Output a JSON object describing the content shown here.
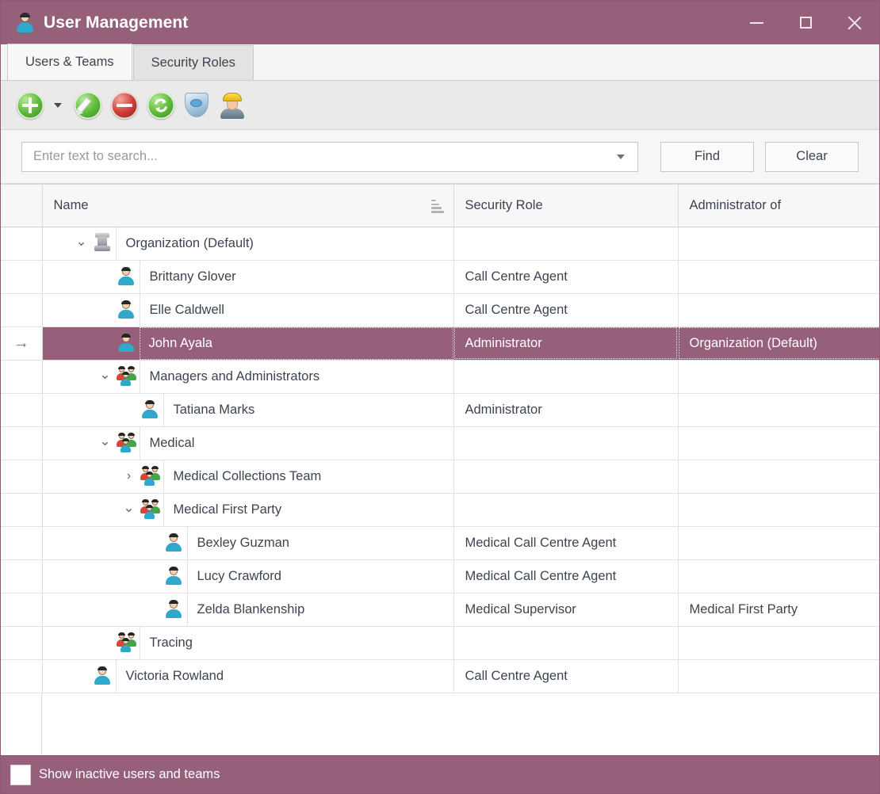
{
  "window": {
    "title": "User Management",
    "title_icon": "user-icon",
    "controls": {
      "minimize": "minimize-icon",
      "maximize": "maximize-icon",
      "close": "close-icon"
    },
    "accent_color": "#96607a"
  },
  "tabs": [
    {
      "label": "Users & Teams",
      "active": true
    },
    {
      "label": "Security Roles",
      "active": false
    }
  ],
  "toolbar": {
    "items": [
      {
        "name": "add-button",
        "icon": "green-plus-orb-icon",
        "has_dropdown": true
      },
      {
        "name": "edit-button",
        "icon": "green-pencil-orb-icon",
        "has_dropdown": false
      },
      {
        "name": "delete-button",
        "icon": "red-minus-orb-icon",
        "has_dropdown": false
      },
      {
        "name": "refresh-button",
        "icon": "green-refresh-orb-icon",
        "has_dropdown": false
      },
      {
        "name": "security-roles-button",
        "icon": "shield-icon",
        "has_dropdown": false
      },
      {
        "name": "impersonate-user-button",
        "icon": "worker-user-icon",
        "has_dropdown": false
      }
    ]
  },
  "search": {
    "placeholder": "Enter text to search...",
    "value": "",
    "dropdown_icon": "chevron-down-icon",
    "find_label": "Find",
    "clear_label": "Clear"
  },
  "grid": {
    "columns": [
      "Name",
      "Security Role",
      "Administrator of"
    ],
    "sort": {
      "column": "Name",
      "direction": "ascending",
      "icon": "sort-ascending-icon"
    },
    "row_indicator": "→",
    "rows": [
      {
        "level": 0,
        "type": "organization",
        "twisty": "expanded",
        "name": "Organization (Default)",
        "role": "",
        "admin_of": "",
        "selected": false,
        "current": false
      },
      {
        "level": 1,
        "type": "user",
        "twisty": "none",
        "name": "Brittany Glover",
        "role": "Call Centre Agent",
        "admin_of": "",
        "selected": false,
        "current": false
      },
      {
        "level": 1,
        "type": "user",
        "twisty": "none",
        "name": "Elle Caldwell",
        "role": "Call Centre Agent",
        "admin_of": "",
        "selected": false,
        "current": false
      },
      {
        "level": 1,
        "type": "user",
        "twisty": "none",
        "name": "John Ayala",
        "role": "Administrator",
        "admin_of": "Organization (Default)",
        "selected": true,
        "current": true
      },
      {
        "level": 1,
        "type": "team",
        "twisty": "expanded",
        "name": "Managers and Administrators",
        "role": "",
        "admin_of": "",
        "selected": false,
        "current": false
      },
      {
        "level": 2,
        "type": "user",
        "twisty": "none",
        "name": "Tatiana Marks",
        "role": "Administrator",
        "admin_of": "",
        "selected": false,
        "current": false
      },
      {
        "level": 1,
        "type": "team",
        "twisty": "expanded",
        "name": "Medical",
        "role": "",
        "admin_of": "",
        "selected": false,
        "current": false
      },
      {
        "level": 2,
        "type": "team",
        "twisty": "collapsed",
        "name": "Medical Collections Team",
        "role": "",
        "admin_of": "",
        "selected": false,
        "current": false
      },
      {
        "level": 2,
        "type": "team",
        "twisty": "expanded",
        "name": "Medical First Party",
        "role": "",
        "admin_of": "",
        "selected": false,
        "current": false
      },
      {
        "level": 3,
        "type": "user",
        "twisty": "none",
        "name": "Bexley Guzman",
        "role": "Medical Call Centre Agent",
        "admin_of": "",
        "selected": false,
        "current": false
      },
      {
        "level": 3,
        "type": "user",
        "twisty": "none",
        "name": "Lucy Crawford",
        "role": "Medical Call Centre Agent",
        "admin_of": "",
        "selected": false,
        "current": false
      },
      {
        "level": 3,
        "type": "user",
        "twisty": "none",
        "name": "Zelda Blankenship",
        "role": "Medical Supervisor",
        "admin_of": "Medical First Party",
        "selected": false,
        "current": false
      },
      {
        "level": 1,
        "type": "team",
        "twisty": "none",
        "name": "Tracing",
        "role": "",
        "admin_of": "",
        "selected": false,
        "current": false
      },
      {
        "level": 0,
        "type": "user",
        "twisty": "none",
        "name": "Victoria Rowland",
        "role": "Call Centre Agent",
        "admin_of": "",
        "selected": false,
        "current": false
      }
    ]
  },
  "statusbar": {
    "checkbox_label": "Show inactive users and teams",
    "checkbox_checked": false
  }
}
